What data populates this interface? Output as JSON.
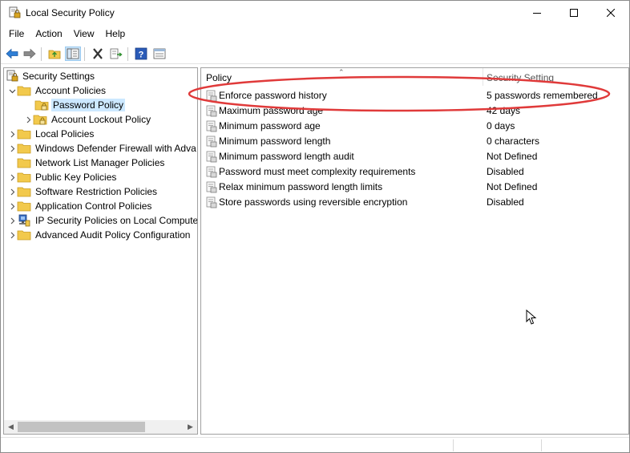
{
  "window": {
    "title": "Local Security Policy"
  },
  "menu": [
    "File",
    "Action",
    "View",
    "Help"
  ],
  "toolbar": {
    "buttons": [
      "back-icon",
      "forward-icon",
      "up-folder-icon",
      "show-hide-tree-icon",
      "delete-icon",
      "export-list-icon",
      "help-icon",
      "properties-icon"
    ]
  },
  "tree": {
    "items": [
      {
        "label": "Security Settings",
        "arrow": "",
        "icon": "security-settings-icon"
      },
      {
        "label": "Account Policies",
        "arrow": "⌄",
        "icon": "folder-icon"
      },
      {
        "label": "Password Policy",
        "arrow": "",
        "icon": "folder-lock-icon"
      },
      {
        "label": "Account Lockout Policy",
        "arrow": "›",
        "icon": "folder-lock-icon"
      },
      {
        "label": "Local Policies",
        "arrow": "›",
        "icon": "folder-icon"
      },
      {
        "label": "Windows Defender Firewall with Adva",
        "arrow": "›",
        "icon": "folder-icon"
      },
      {
        "label": "Network List Manager Policies",
        "arrow": "",
        "icon": "folder-icon"
      },
      {
        "label": "Public Key Policies",
        "arrow": "›",
        "icon": "folder-icon"
      },
      {
        "label": "Software Restriction Policies",
        "arrow": "›",
        "icon": "folder-icon"
      },
      {
        "label": "Application Control Policies",
        "arrow": "›",
        "icon": "folder-icon"
      },
      {
        "label": "IP Security Policies on Local Compute",
        "arrow": "›",
        "icon": "ip-security-icon"
      },
      {
        "label": "Advanced Audit Policy Configuration",
        "arrow": "›",
        "icon": "folder-icon"
      }
    ]
  },
  "list": {
    "columns": {
      "policy": "Policy",
      "setting": "Security Setting"
    },
    "rows": [
      {
        "name": "Enforce password history",
        "value": "5 passwords remembered"
      },
      {
        "name": "Maximum password age",
        "value": "42 days"
      },
      {
        "name": "Minimum password age",
        "value": "0 days"
      },
      {
        "name": "Minimum password length",
        "value": "0 characters"
      },
      {
        "name": "Minimum password length audit",
        "value": "Not Defined"
      },
      {
        "name": "Password must meet complexity requirements",
        "value": "Disabled"
      },
      {
        "name": "Relax minimum password length limits",
        "value": "Not Defined"
      },
      {
        "name": "Store passwords using reversible encryption",
        "value": "Disabled"
      }
    ]
  },
  "colors": {
    "selection": "#cce8ff",
    "highlight_ring": "#e03a3a",
    "folder": "#f2c94c"
  }
}
